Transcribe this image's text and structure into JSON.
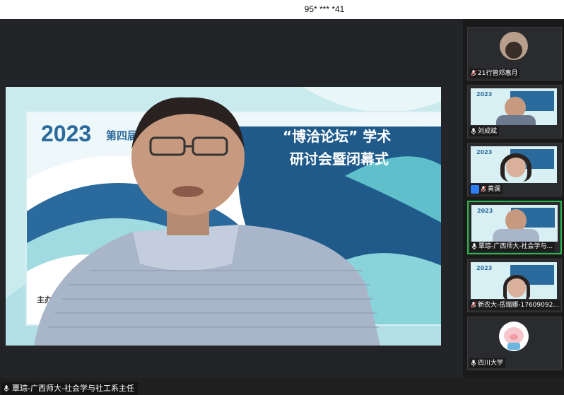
{
  "window": {
    "meeting_id": "95* *** *41"
  },
  "main_video": {
    "slide_year": "2023",
    "slide_edition": "第四届",
    "slide_title_line1": "“博洽论坛” 学术",
    "slide_title_line2": "研讨会暨闭幕式",
    "slide_organizer_label": "主办：",
    "speaker_name": "覃琮-广西师大-社会学与社工系主任"
  },
  "participants": [
    {
      "name": "21行管邓惠月",
      "mic": "muted"
    },
    {
      "name": "刘成斌",
      "mic": "on"
    },
    {
      "name": "黄澜",
      "mic": "muted"
    },
    {
      "name": "覃琮-广西师大-社会学与...",
      "mic": "on"
    },
    {
      "name": "新农大-岳瑞娜-17609092...",
      "mic": "muted"
    },
    {
      "name": "四川大学",
      "mic": "on"
    }
  ],
  "colors": {
    "accent_active": "#2db84b",
    "slide_blue": "#2b6a9c",
    "slide_teal": "#7fd2d9"
  }
}
